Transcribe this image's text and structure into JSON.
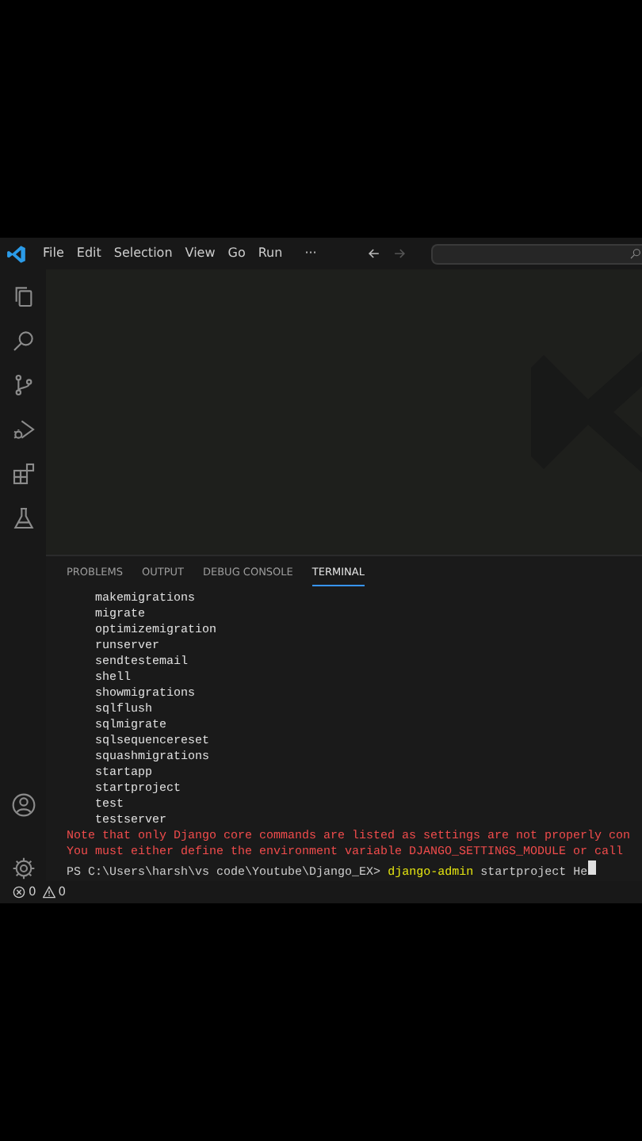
{
  "title_bar": {
    "menu": [
      "File",
      "Edit",
      "Selection",
      "View",
      "Go",
      "Run"
    ],
    "more": "···",
    "back_disabled": false,
    "forward_disabled": true
  },
  "panel": {
    "tabs": [
      {
        "label": "PROBLEMS",
        "selected": false
      },
      {
        "label": "OUTPUT",
        "selected": false
      },
      {
        "label": "DEBUG CONSOLE",
        "selected": false
      },
      {
        "label": "TERMINAL",
        "selected": true
      }
    ]
  },
  "terminal": {
    "lines": [
      {
        "kind": "output",
        "text": "    makemigrations"
      },
      {
        "kind": "output",
        "text": "    migrate"
      },
      {
        "kind": "output",
        "text": "    optimizemigration"
      },
      {
        "kind": "output",
        "text": "    runserver"
      },
      {
        "kind": "output",
        "text": "    sendtestemail"
      },
      {
        "kind": "output",
        "text": "    shell"
      },
      {
        "kind": "output",
        "text": "    showmigrations"
      },
      {
        "kind": "output",
        "text": "    sqlflush"
      },
      {
        "kind": "output",
        "text": "    sqlmigrate"
      },
      {
        "kind": "output",
        "text": "    sqlsequencereset"
      },
      {
        "kind": "output",
        "text": "    squashmigrations"
      },
      {
        "kind": "output",
        "text": "    startapp"
      },
      {
        "kind": "output",
        "text": "    startproject"
      },
      {
        "kind": "output",
        "text": "    test"
      },
      {
        "kind": "output",
        "text": "    testserver"
      },
      {
        "kind": "error",
        "text": "Note that only Django core commands are listed as settings are not properly con"
      },
      {
        "kind": "error",
        "text": "You must either define the environment variable DJANGO_SETTINGS_MODULE or call"
      }
    ],
    "prompt": {
      "path": "PS C:\\Users\\harsh\\vs code\\Youtube\\Django_EX>",
      "command": "django-admin",
      "args": "startproject He"
    }
  },
  "status_bar": {
    "errors": "0",
    "warnings": "0"
  }
}
